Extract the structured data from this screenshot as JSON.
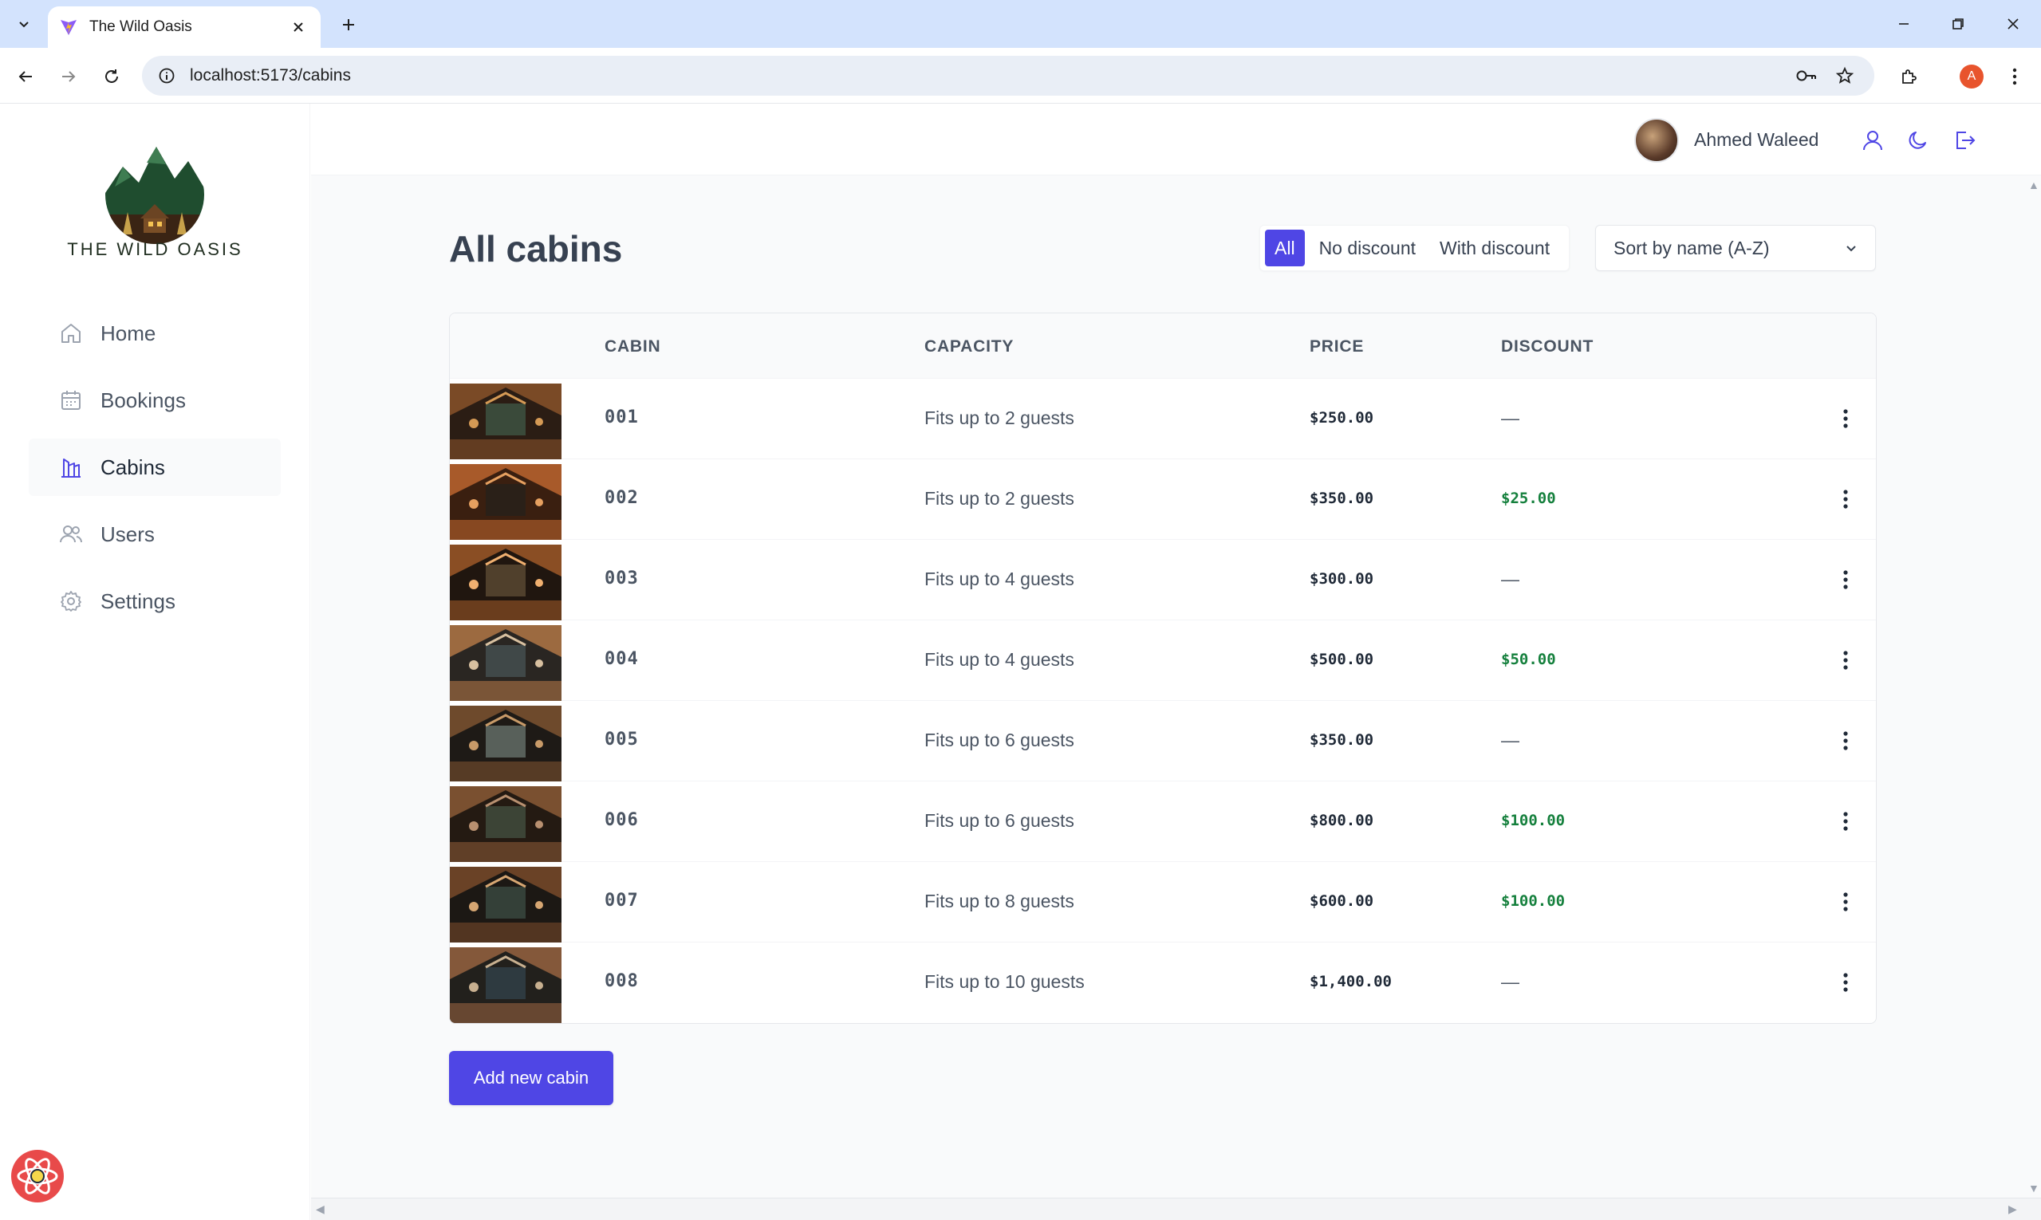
{
  "browser": {
    "tab_title": "The Wild Oasis",
    "url": "localhost:5173/cabins",
    "profile_initial": "A"
  },
  "brand": {
    "name": "THE WILD OASIS"
  },
  "sidebar": {
    "items": [
      {
        "label": "Home",
        "icon": "home-icon"
      },
      {
        "label": "Bookings",
        "icon": "calendar-icon"
      },
      {
        "label": "Cabins",
        "icon": "cabins-icon",
        "active": true
      },
      {
        "label": "Users",
        "icon": "users-icon"
      },
      {
        "label": "Settings",
        "icon": "gear-icon"
      }
    ]
  },
  "header": {
    "username": "Ahmed Waleed"
  },
  "page": {
    "title": "All cabins",
    "filters": [
      "All",
      "No discount",
      "With discount"
    ],
    "active_filter": "All",
    "sort_label": "Sort by name (A-Z)",
    "add_button": "Add new cabin"
  },
  "table": {
    "columns": [
      "CABIN",
      "CAPACITY",
      "PRICE",
      "DISCOUNT"
    ],
    "rows": [
      {
        "name": "001",
        "capacity": "Fits up to 2 guests",
        "price": "$250.00",
        "discount": "—"
      },
      {
        "name": "002",
        "capacity": "Fits up to 2 guests",
        "price": "$350.00",
        "discount": "$25.00"
      },
      {
        "name": "003",
        "capacity": "Fits up to 4 guests",
        "price": "$300.00",
        "discount": "—"
      },
      {
        "name": "004",
        "capacity": "Fits up to 4 guests",
        "price": "$500.00",
        "discount": "$50.00"
      },
      {
        "name": "005",
        "capacity": "Fits up to 6 guests",
        "price": "$350.00",
        "discount": "—"
      },
      {
        "name": "006",
        "capacity": "Fits up to 6 guests",
        "price": "$800.00",
        "discount": "$100.00"
      },
      {
        "name": "007",
        "capacity": "Fits up to 8 guests",
        "price": "$600.00",
        "discount": "$100.00"
      },
      {
        "name": "008",
        "capacity": "Fits up to 10 guests",
        "price": "$1,400.00",
        "discount": "—"
      }
    ]
  },
  "colors": {
    "brand": "#4f46e5",
    "discount": "#15803d",
    "chrome": "#d3e3fd"
  }
}
